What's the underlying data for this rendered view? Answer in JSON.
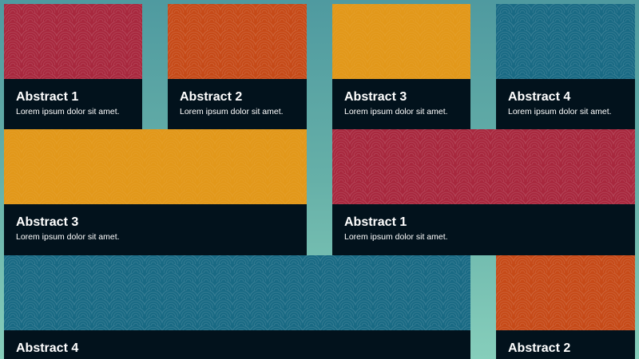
{
  "cards": [
    {
      "title": "Abstract 1",
      "description": "Lorem ipsum dolor sit amet.",
      "pattern_color": "#a8283e"
    },
    {
      "title": "Abstract 2",
      "description": "Lorem ipsum dolor sit amet.",
      "pattern_color": "#c64a18"
    },
    {
      "title": "Abstract 3",
      "description": "Lorem ipsum dolor sit amet.",
      "pattern_color": "#e2981a"
    },
    {
      "title": "Abstract 4",
      "description": "Lorem ipsum dolor sit amet.",
      "pattern_color": "#196a84"
    },
    {
      "title": "Abstract 3",
      "description": "Lorem ipsum dolor sit amet.",
      "pattern_color": "#e2981a"
    },
    {
      "title": "Abstract 1",
      "description": "Lorem ipsum dolor sit amet.",
      "pattern_color": "#a8283e"
    },
    {
      "title": "Abstract 4",
      "description": "",
      "pattern_color": "#196a84"
    },
    {
      "title": "Abstract 2",
      "description": "",
      "pattern_color": "#c64a18"
    }
  ],
  "colors": {
    "card_body": "#02121c",
    "background_top": "#4f9aa0",
    "background_bottom": "#86cebb"
  }
}
